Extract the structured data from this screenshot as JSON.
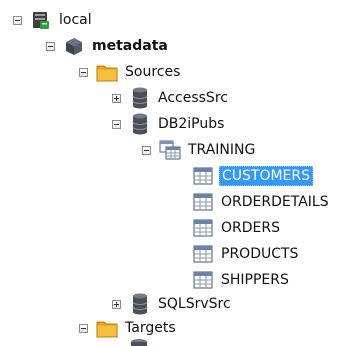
{
  "tree": {
    "root": {
      "label": "local",
      "icon": "server-icon"
    },
    "metadata": {
      "label": "metadata",
      "icon": "cube-icon"
    },
    "sources": {
      "label": "Sources",
      "icon": "folder-icon"
    },
    "accesssrc": {
      "label": "AccessSrc",
      "icon": "database-icon"
    },
    "db2ipubs": {
      "label": "DB2iPubs",
      "icon": "database-icon"
    },
    "training": {
      "label": "TRAINING",
      "icon": "schema-icon"
    },
    "tables": [
      {
        "label": "CUSTOMERS",
        "icon": "table-icon",
        "selected": true
      },
      {
        "label": "ORDERDETAILS",
        "icon": "table-icon",
        "selected": false
      },
      {
        "label": "ORDERS",
        "icon": "table-icon",
        "selected": false
      },
      {
        "label": "PRODUCTS",
        "icon": "table-icon",
        "selected": false
      },
      {
        "label": "SHIPPERS",
        "icon": "table-icon",
        "selected": false
      }
    ],
    "sqlsrvsrc": {
      "label": "SQLSrvSrc",
      "icon": "database-icon"
    },
    "targets": {
      "label": "Targets",
      "icon": "folder-icon"
    }
  },
  "colors": {
    "selection": "#3399ff",
    "folder": "#f5b324",
    "database": "#4a4f57",
    "server": "#2e7d32"
  }
}
